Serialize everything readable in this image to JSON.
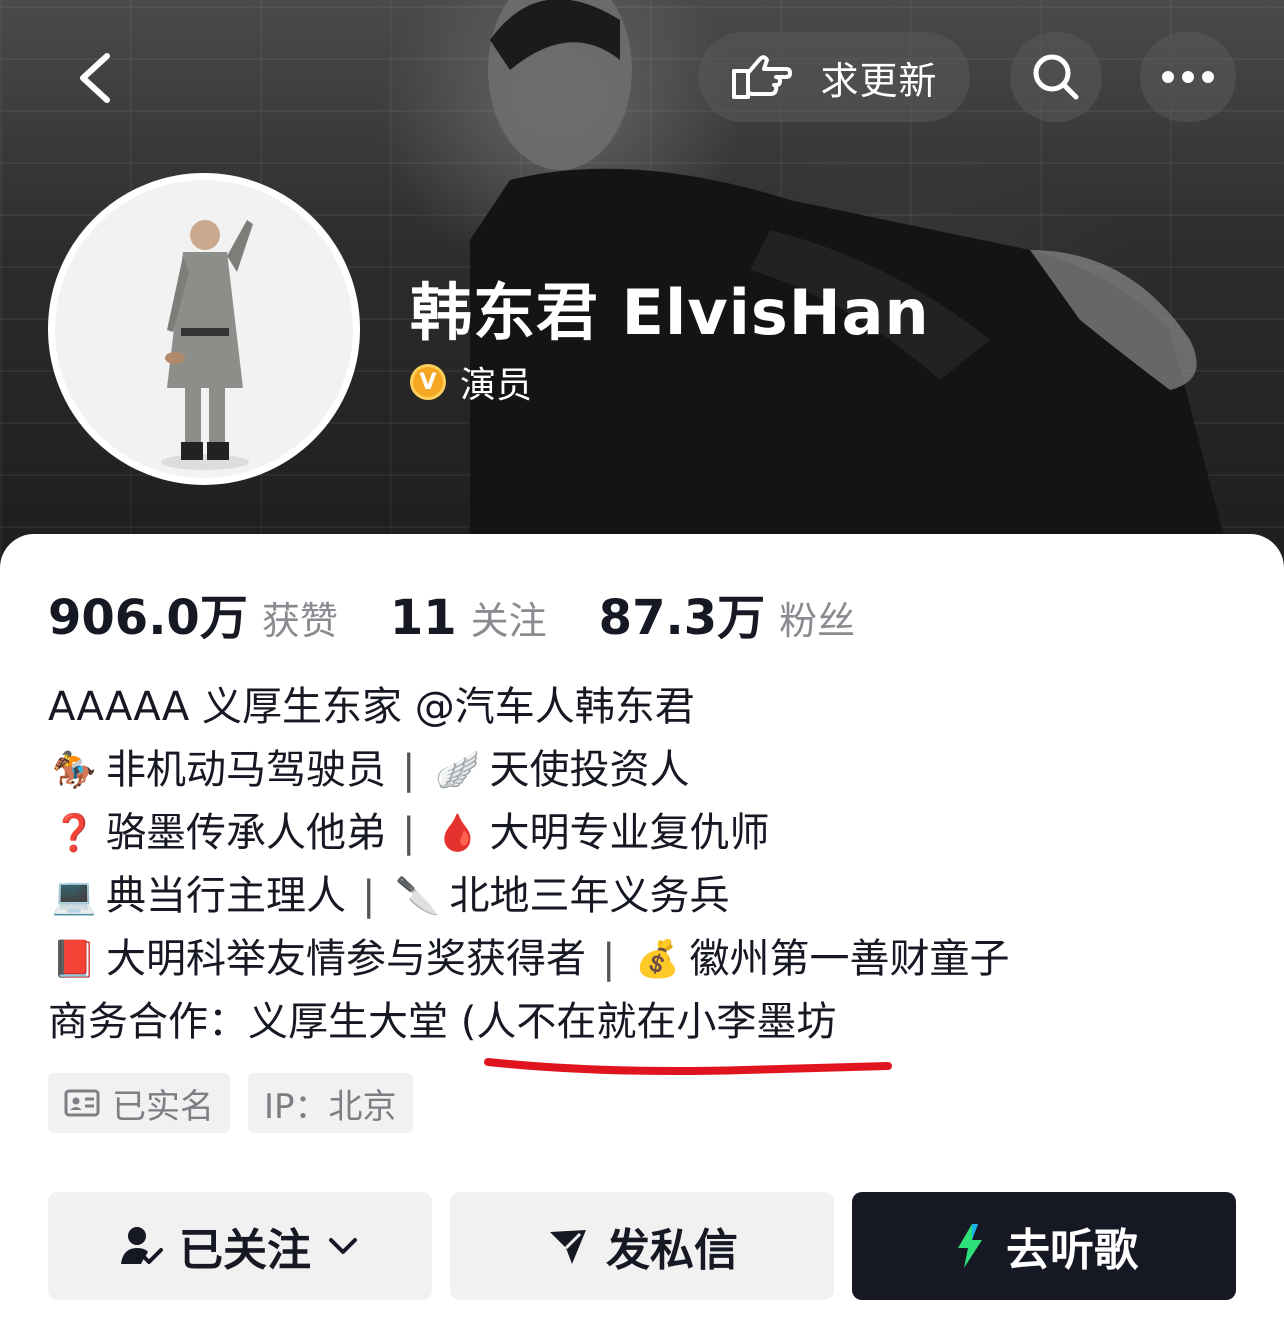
{
  "header": {
    "update_label": "求更新"
  },
  "profile": {
    "name": "韩东君 ElvisHan",
    "verified_badge": "V",
    "role": "演员"
  },
  "stats": [
    {
      "value": "906.0万",
      "label": "获赞"
    },
    {
      "value": "11",
      "label": "关注"
    },
    {
      "value": "87.3万",
      "label": "粉丝"
    }
  ],
  "bio": {
    "line1": "AAAAA 义厚生东家 @汽车人韩东君",
    "line2_a": "非机动马驾驶员",
    "line2_b": "天使投资人",
    "line3_a": "骆墨传承人他弟",
    "line3_b": "大明专业复仇师",
    "line4_a": "典当行主理人",
    "line4_b": "北地三年义务兵",
    "line5_a": "大明科举友情参与奖获得者",
    "line5_b": "徽州第一善财童子",
    "line6": "商务合作：义厚生大堂 (人不在就在小李墨坊",
    "separator": "|",
    "emojis": {
      "horse": "🏇",
      "wing": "🪽",
      "question": "❓",
      "blood": "🩸",
      "laptop": "💻",
      "knife": "🔪",
      "book": "📕",
      "money": "💰"
    }
  },
  "tags": {
    "verified": "已实名",
    "ip": "IP：北京"
  },
  "actions": {
    "follow": "已关注",
    "message": "发私信",
    "music": "去听歌"
  },
  "colors": {
    "accent_underline": "#e0141e",
    "badge": "#f5a623",
    "dark_button": "#161823"
  }
}
